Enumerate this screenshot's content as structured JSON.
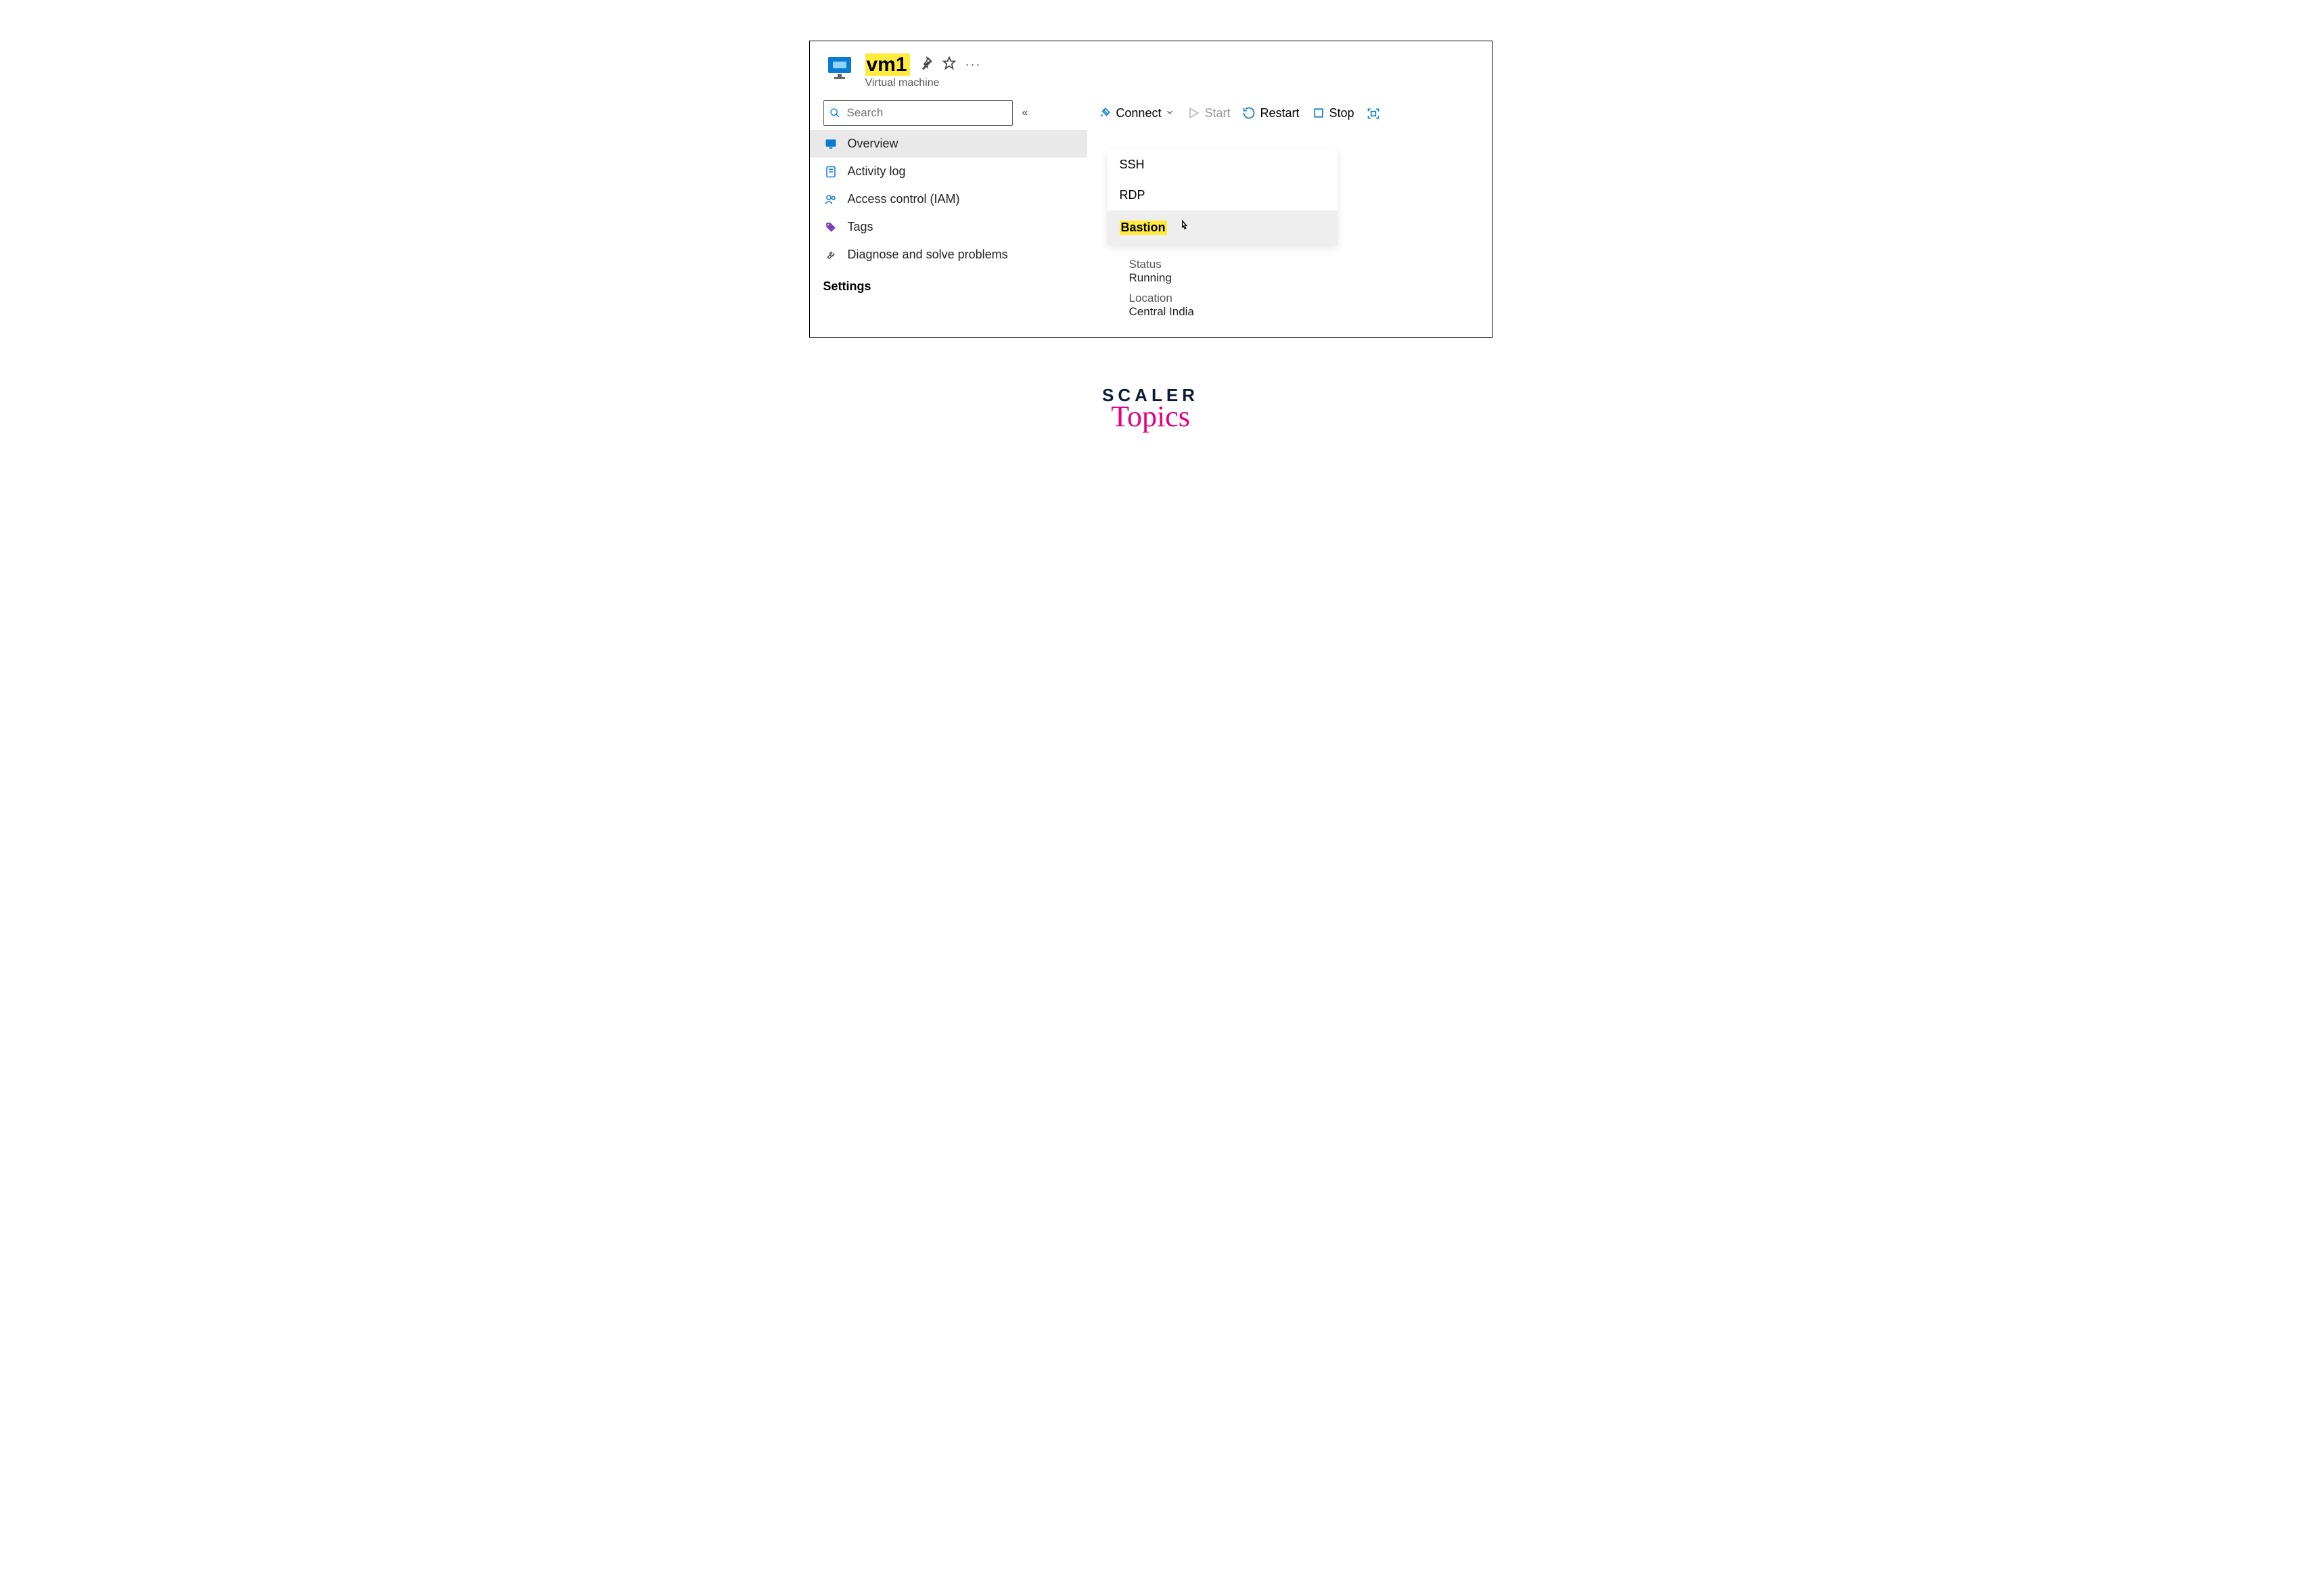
{
  "header": {
    "title": "vm1",
    "subtitle": "Virtual machine"
  },
  "search": {
    "placeholder": "Search"
  },
  "toolbar": {
    "connect": "Connect",
    "start": "Start",
    "restart": "Restart",
    "stop": "Stop"
  },
  "nav": {
    "overview": "Overview",
    "activity": "Activity log",
    "iam": "Access control (IAM)",
    "tags": "Tags",
    "diagnose": "Diagnose and solve problems",
    "settings": "Settings"
  },
  "connect_menu": {
    "ssh": "SSH",
    "rdp": "RDP",
    "bastion": "Bastion"
  },
  "essentials": {
    "status_label": "Status",
    "status_value": "Running",
    "location_label": "Location",
    "location_value": "Central India"
  },
  "footer": {
    "line1": "SCALER",
    "line2": "Topics"
  }
}
